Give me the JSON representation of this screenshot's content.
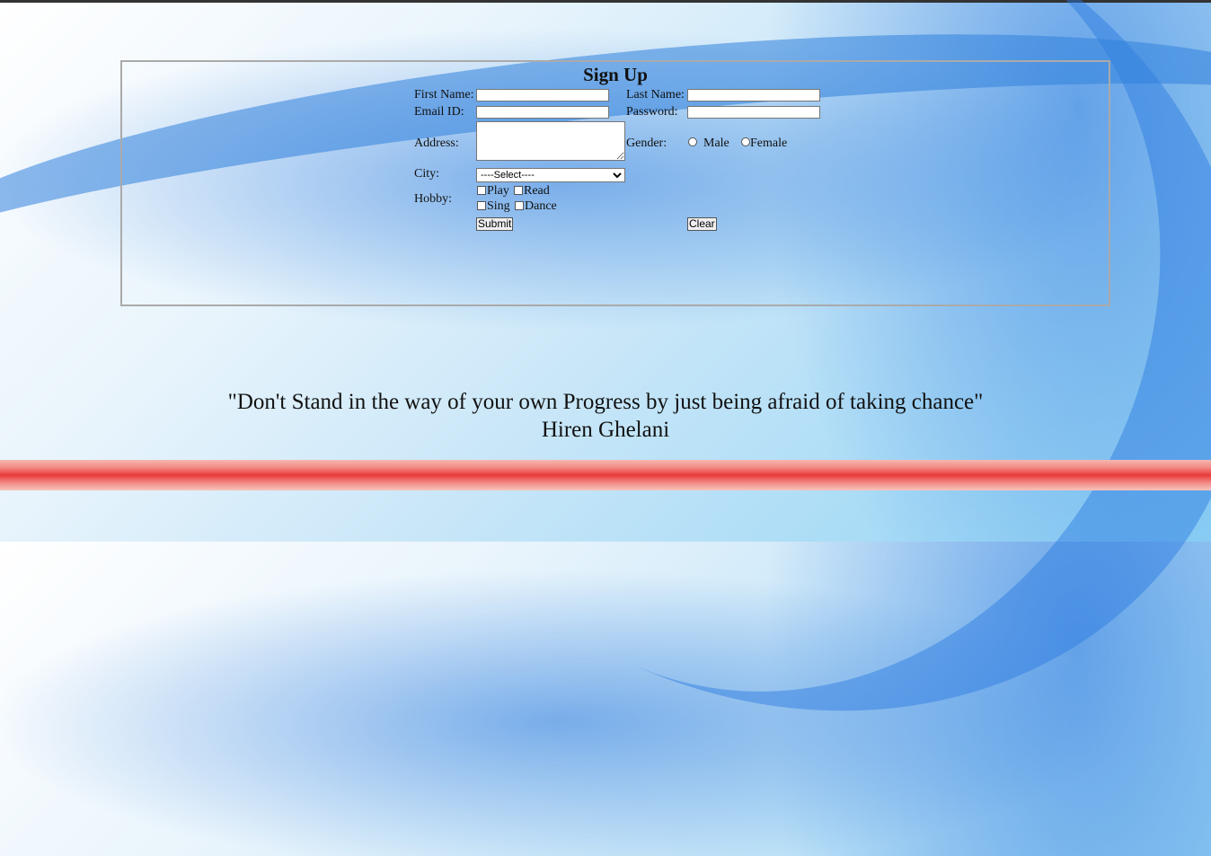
{
  "form": {
    "title": "Sign Up",
    "first_name_label": "First Name:",
    "last_name_label": "Last Name:",
    "email_label": "Email ID:",
    "password_label": "Password:",
    "address_label": "Address:",
    "gender_label": "Gender:",
    "gender_options": [
      "Male",
      "Female"
    ],
    "city_label": "City:",
    "city_selected": "----Select----",
    "hobby_label": "Hobby:",
    "hobbies": [
      "Play",
      "Read",
      "Sing",
      "Dance"
    ],
    "submit_label": "Submit",
    "clear_label": "Clear"
  },
  "quote": {
    "text": "\"Don't Stand in the way of your own Progress by just being afraid of taking chance\"",
    "author": "Hiren Ghelani"
  },
  "colors": {
    "form_border": "#aaaaaa",
    "accent_bar": "#e83a3a"
  }
}
